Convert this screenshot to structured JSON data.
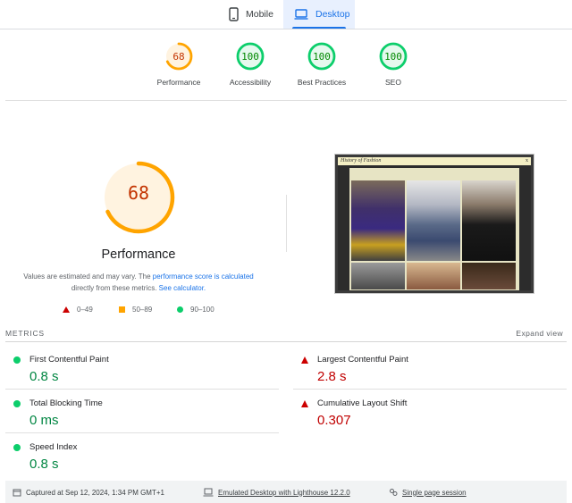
{
  "tabs": [
    {
      "label": "Mobile",
      "icon": "phone-icon"
    },
    {
      "label": "Desktop",
      "icon": "laptop-icon"
    }
  ],
  "categories": [
    {
      "score": "68",
      "label": "Performance",
      "value": 0.68,
      "color": "#ffa400",
      "textColor": "#c33300",
      "bg": "#fff3e0"
    },
    {
      "score": "100",
      "label": "Accessibility",
      "value": 1.0,
      "color": "#0cce6b",
      "textColor": "#008800",
      "bg": "#e6f9ee"
    },
    {
      "score": "100",
      "label": "Best Practices",
      "value": 1.0,
      "color": "#0cce6b",
      "textColor": "#008800",
      "bg": "#e6f9ee"
    },
    {
      "score": "100",
      "label": "SEO",
      "value": 1.0,
      "color": "#0cce6b",
      "textColor": "#008800",
      "bg": "#e6f9ee"
    }
  ],
  "main": {
    "score": "68",
    "value": 0.68,
    "title": "Performance",
    "note_prefix": "Values are estimated and may vary. The ",
    "note_link1": "performance score is calculated",
    "note_middle": " directly from these metrics. ",
    "note_link2": "See calculator."
  },
  "legend": {
    "poor": "0–49",
    "average": "50–89",
    "good": "90–100"
  },
  "thumbnail": {
    "site_title": "History of Fashion",
    "close": "x"
  },
  "metrics": {
    "title": "METRICS",
    "expand": "Expand view",
    "items": [
      {
        "name": "First Contentful Paint",
        "value": "0.8 s",
        "status": "good"
      },
      {
        "name": "Largest Contentful Paint",
        "value": "2.8 s",
        "status": "bad"
      },
      {
        "name": "Total Blocking Time",
        "value": "0 ms",
        "status": "good"
      },
      {
        "name": "Cumulative Layout Shift",
        "value": "0.307",
        "status": "bad"
      },
      {
        "name": "Speed Index",
        "value": "0.8 s",
        "status": "good"
      }
    ]
  },
  "footer": {
    "captured": "Captured at Sep 12, 2024, 1:34 PM GMT+1",
    "emulated": "Emulated Desktop with Lighthouse 12.2.0",
    "session": "Single page session"
  }
}
